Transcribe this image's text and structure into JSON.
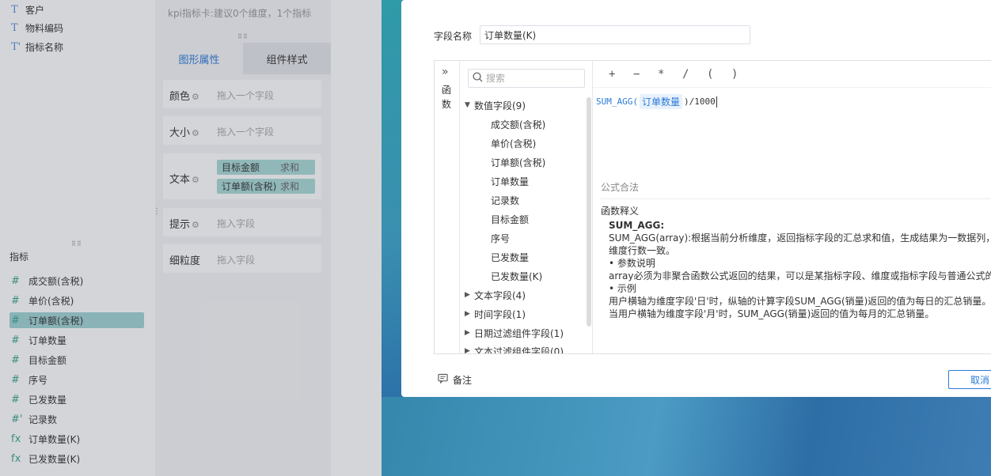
{
  "left_panel": {
    "dimension_items": [
      {
        "icon": "T",
        "label": "客户"
      },
      {
        "icon": "T",
        "label": "物料编码"
      },
      {
        "icon": "T'",
        "label": "指标名称"
      }
    ],
    "metric_section_title": "指标",
    "metric_items": [
      {
        "icon": "#",
        "label": "成交额(含税)"
      },
      {
        "icon": "#",
        "label": "单价(含税)"
      },
      {
        "icon": "#",
        "label": "订单额(含税)"
      },
      {
        "icon": "#",
        "label": "订单数量"
      },
      {
        "icon": "#",
        "label": "目标金额"
      },
      {
        "icon": "#",
        "label": "序号"
      },
      {
        "icon": "#",
        "label": "已发数量"
      },
      {
        "icon": "#'",
        "label": "记录数"
      },
      {
        "icon": "fx",
        "label": "订单数量(K)"
      },
      {
        "icon": "fx",
        "label": "已发数量(K)"
      }
    ],
    "active_metric_index": 2
  },
  "mid_panel": {
    "hint": "kpi指标卡:建议0个维度，1个指标",
    "tabs": [
      {
        "label": "图形属性",
        "active": true
      },
      {
        "label": "组件样式",
        "active": false
      }
    ],
    "rows": {
      "color": {
        "label": "颜色",
        "value": "拖入一个字段"
      },
      "size": {
        "label": "大小",
        "value": "拖入一个字段"
      },
      "text": {
        "label": "文本",
        "chips": [
          {
            "name": "目标金额",
            "agg": "求和"
          },
          {
            "name": "订单额(含税)",
            "agg": "求和"
          }
        ]
      },
      "tooltip": {
        "label": "提示",
        "value": "拖入字段"
      },
      "granularity": {
        "label": "细粒度",
        "value": "拖入字段"
      }
    }
  },
  "dialog": {
    "field_name_label": "字段名称",
    "field_name_value": "订单数量(K)",
    "func_rail_label": "函数",
    "search_placeholder": "搜索",
    "tree": {
      "numeric_group": "数值字段(9)",
      "numeric_children": [
        "成交额(含税)",
        "单价(含税)",
        "订单额(含税)",
        "订单数量",
        "记录数",
        "目标金额",
        "序号",
        "已发数量",
        "已发数量(K)"
      ],
      "text_group": "文本字段(4)",
      "time_group": "时间字段(1)",
      "date_filter_group": "日期过滤组件字段(1)",
      "text_filter_group": "文本过滤组件字段(0)"
    },
    "operators": [
      "+",
      "−",
      "*",
      "/",
      "(",
      ")"
    ],
    "formula": {
      "func": "SUM_AGG(",
      "token": "订单数量",
      "rest": ")/1000"
    },
    "formula_status": "公式合法",
    "desc_title": "函数释义",
    "desc": {
      "name": "SUM_AGG:",
      "line1": "SUM_AGG(array):根据当前分析维度，返回指标字段的汇总求和值，生成结果为一数据列，",
      "line2": "维度行数一致。",
      "line3": "• 参数说明",
      "line4": "array必须为非聚合函数公式返回的结果，可以是某指标字段、维度或指标字段与普通公式的",
      "line5": "• 示例",
      "line6": "用户横轴为维度字段'日'时，纵轴的计算字段SUM_AGG(销量)返回的值为每日的汇总销量。",
      "line7": "当用户横轴为维度字段'月'时，SUM_AGG(销量)返回的值为每月的汇总销量。"
    },
    "note_label": "备注",
    "cancel_label": "取消"
  }
}
